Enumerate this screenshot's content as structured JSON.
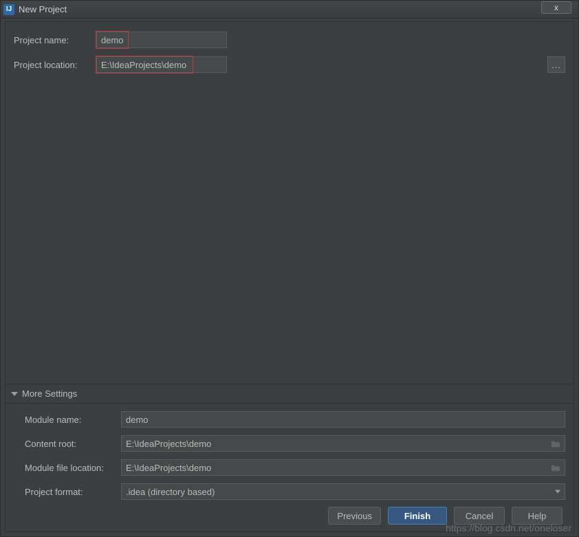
{
  "window": {
    "title": "New Project"
  },
  "fields": {
    "project_name_label": "Project name:",
    "project_name_value": "demo",
    "project_location_label": "Project location:",
    "project_location_value": "E:\\IdeaProjects\\demo",
    "browse_glyph": "..."
  },
  "more_settings": {
    "header": "More Settings",
    "module_name_label": "Module name:",
    "module_name_value": "demo",
    "content_root_label": "Content root:",
    "content_root_value": "E:\\IdeaProjects\\demo",
    "module_file_location_label": "Module file location:",
    "module_file_location_value": "E:\\IdeaProjects\\demo",
    "project_format_label": "Project format:",
    "project_format_value": ".idea (directory based)"
  },
  "buttons": {
    "previous": "Previous",
    "finish": "Finish",
    "cancel": "Cancel",
    "help": "Help"
  },
  "watermark": "https://blog.csdn.net/oneloser"
}
